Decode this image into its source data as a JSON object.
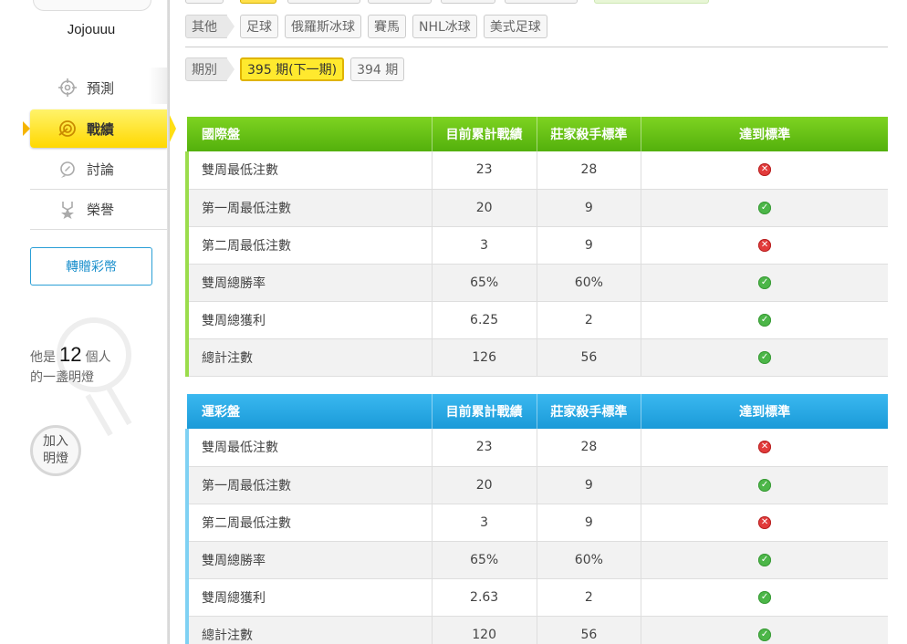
{
  "sidebar": {
    "username": "Jojouuu",
    "nav": [
      {
        "label": "預測",
        "icon": "target-icon"
      },
      {
        "label": "戰績",
        "icon": "record-icon"
      },
      {
        "label": "討論",
        "icon": "discuss-icon"
      },
      {
        "label": "榮譽",
        "icon": "honor-icon"
      }
    ],
    "gift_button": "轉贈彩幣",
    "lamp": {
      "prefix": "他是",
      "count": "12",
      "suffix": "個人",
      "line2": "的一盞明燈"
    },
    "join_button": {
      "line1": "加入",
      "line2": "明燈"
    }
  },
  "filters": {
    "sport_label": "其他",
    "sports": [
      "足球",
      "俄羅斯冰球",
      "賽馬",
      "NHL冰球",
      "美式足球"
    ],
    "period_label": "期別",
    "periods": [
      "395 期(下一期)",
      "394 期"
    ],
    "selected_period": "395 期(下一期)"
  },
  "tables": [
    {
      "title": "國際盤",
      "headers": [
        "目前累計戰績",
        "莊家殺手標準",
        "達到標準"
      ],
      "rows": [
        {
          "label": "雙周最低注數",
          "current": "23",
          "standard": "28",
          "met": false
        },
        {
          "label": "第一周最低注數",
          "current": "20",
          "standard": "9",
          "met": true
        },
        {
          "label": "第二周最低注數",
          "current": "3",
          "standard": "9",
          "met": false
        },
        {
          "label": "雙周總勝率",
          "current": "65%",
          "standard": "60%",
          "met": true
        },
        {
          "label": "雙周總獲利",
          "current": "6.25",
          "standard": "2",
          "met": true
        },
        {
          "label": "總計注數",
          "current": "126",
          "standard": "56",
          "met": true
        }
      ]
    },
    {
      "title": "運彩盤",
      "headers": [
        "目前累計戰績",
        "莊家殺手標準",
        "達到標準"
      ],
      "rows": [
        {
          "label": "雙周最低注數",
          "current": "23",
          "standard": "28",
          "met": false
        },
        {
          "label": "第一周最低注數",
          "current": "20",
          "standard": "9",
          "met": true
        },
        {
          "label": "第二周最低注數",
          "current": "3",
          "standard": "9",
          "met": false
        },
        {
          "label": "雙周總勝率",
          "current": "65%",
          "standard": "60%",
          "met": true
        },
        {
          "label": "雙周總獲利",
          "current": "2.63",
          "standard": "2",
          "met": true
        },
        {
          "label": "總計注數",
          "current": "120",
          "standard": "56",
          "met": true
        }
      ]
    }
  ],
  "colors": {
    "intl_header": "#5bb812",
    "sports_header": "#23a5e2",
    "active_nav": "#ffde14",
    "ok": "#4cb648",
    "fail": "#e23b3b"
  }
}
